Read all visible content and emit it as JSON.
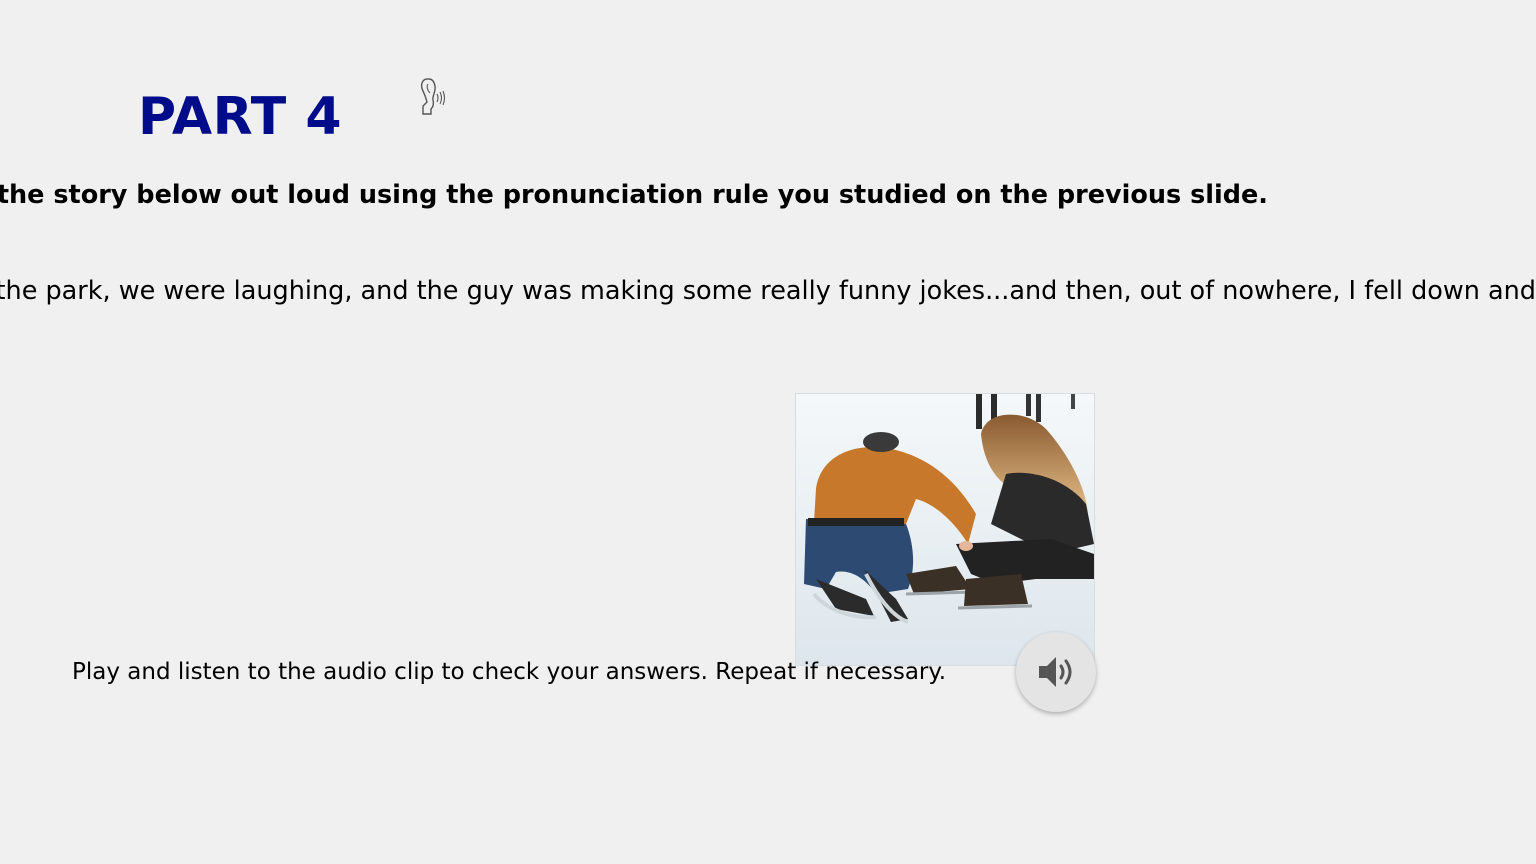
{
  "slide": {
    "title": "PART 4",
    "instruction": "Read the story below out loud using the pronunciation rule you studied on the previous slide.",
    "story": "We were skating at the park, we were laughing, and the guy was making some really funny jokes...and then, out of nowhere, I fell down and",
    "audio_prompt": "Play and listen to the audio clip to check your answers. Repeat if necessary.",
    "title_color": "#000c8a"
  },
  "icons": {
    "listen": "ear-listening-icon",
    "audio": "speaker-volume-icon"
  }
}
